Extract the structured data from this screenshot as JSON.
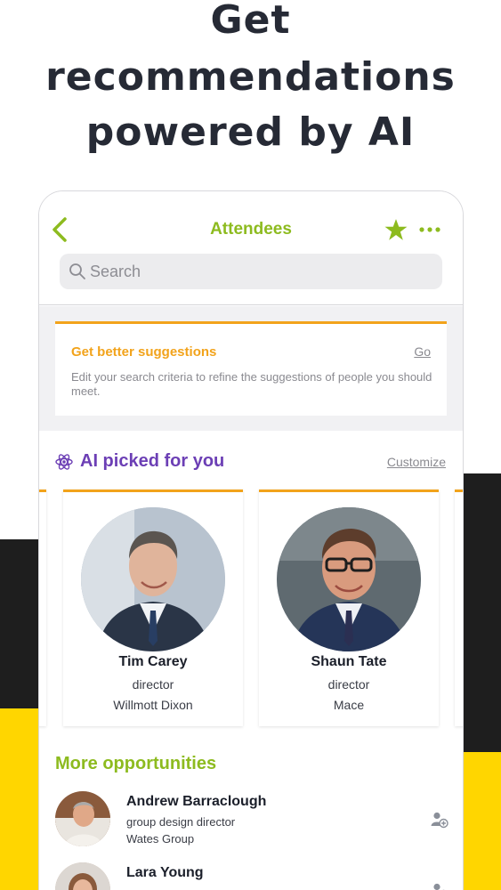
{
  "headline": {
    "line1": "Get",
    "line2": "recommendations",
    "line3": "powered by  AI"
  },
  "colors": {
    "accent_green": "#8dbb1f",
    "accent_orange": "#f2a31b",
    "ai_purple": "#6c3fb5",
    "bg_black": "#1e1e1e",
    "bg_yellow": "#ffd600"
  },
  "header": {
    "title": "Attendees",
    "back_icon": "chevron-left-icon",
    "star_icon": "star-icon",
    "more_icon": "more-dots-icon"
  },
  "search": {
    "placeholder": "Search"
  },
  "suggestions": {
    "title": "Get better suggestions",
    "go_label": "Go",
    "text": "Edit your search criteria to refine the suggestions of people you should meet."
  },
  "ai_section": {
    "title": "AI picked for you",
    "customize_label": "Customize",
    "people": [
      {
        "name": "Tim Carey",
        "role": "director",
        "company": "Willmott Dixon"
      },
      {
        "name": "Shaun Tate",
        "role": "director",
        "company": "Mace"
      }
    ]
  },
  "more": {
    "title": "More opportunities",
    "items": [
      {
        "name": "Andrew Barraclough",
        "role": "group design director",
        "company": "Wates Group"
      },
      {
        "name": "Lara Young",
        "role": "",
        "company": ""
      }
    ]
  }
}
